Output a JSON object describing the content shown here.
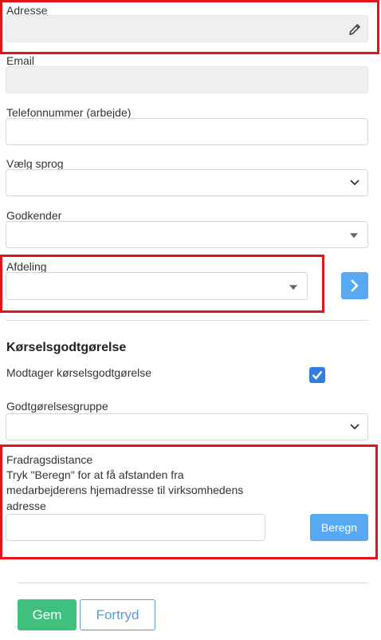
{
  "address": {
    "label": "Adresse",
    "value": "",
    "edit_icon": "pencil-icon"
  },
  "email": {
    "label": "Email",
    "value": ""
  },
  "phone": {
    "label": "Telefonnummer (arbejde)",
    "value": ""
  },
  "language": {
    "label": "Vælg sprog",
    "value": ""
  },
  "approver": {
    "label": "Godkender",
    "value": ""
  },
  "department": {
    "label": "Afdeling",
    "value": "",
    "next_icon": "chevron-right-icon"
  },
  "mileage": {
    "section_title": "Kørselsgodtgørelse",
    "receives_label": "Modtager kørselsgodtgørelse",
    "receives_checked": true,
    "group_label": "Godtgørelsesgruppe",
    "group_value": "",
    "deduction_label": "Fradragsdistance",
    "deduction_help_line1": "Tryk \"Beregn\" for at få afstanden fra",
    "deduction_help_line2": "medarbejderens hjemadresse til virksomhedens",
    "deduction_help_line3": "adresse",
    "deduction_value": "",
    "calculate_label": "Beregn"
  },
  "footer": {
    "save_label": "Gem",
    "cancel_label": "Fortryd"
  },
  "colors": {
    "highlight": "#e4141b",
    "primary": "#58a9f3",
    "save": "#40c07e",
    "checkbox": "#2f7de1"
  }
}
